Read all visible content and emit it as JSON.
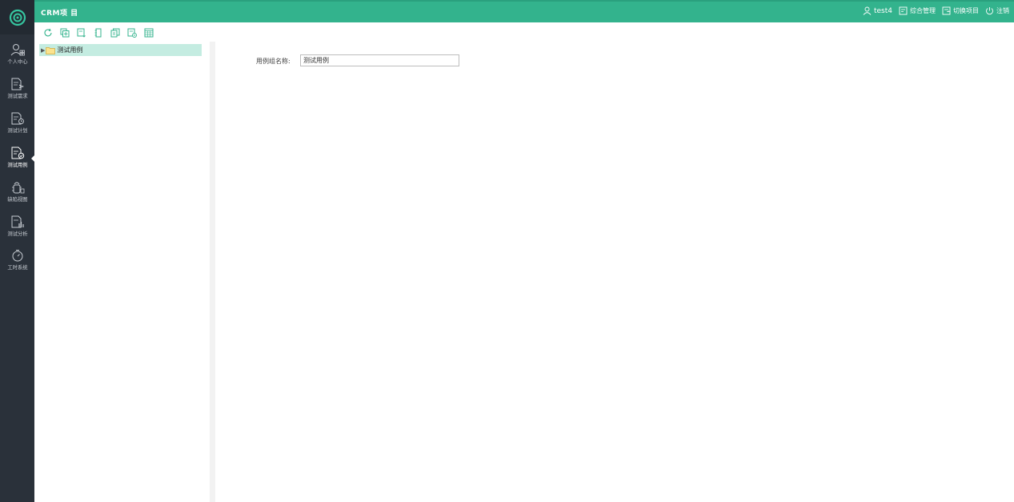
{
  "header": {
    "project_title": "CRM项 目",
    "username": "test4",
    "menu": [
      {
        "label": "综合管理",
        "icon": "management-icon"
      },
      {
        "label": "切换项目",
        "icon": "switch-project-icon"
      },
      {
        "label": "注销",
        "icon": "logout-icon"
      }
    ]
  },
  "sidebar": {
    "active_index": 3,
    "items": [
      {
        "label": "个人中心",
        "icon": "user-center-icon"
      },
      {
        "label": "测试需求",
        "icon": "test-requirements-icon"
      },
      {
        "label": "测试计划",
        "icon": "test-plan-icon"
      },
      {
        "label": "测试用例",
        "icon": "test-case-icon"
      },
      {
        "label": "缺陷视图",
        "icon": "defect-view-icon"
      },
      {
        "label": "测试分析",
        "icon": "test-analysis-icon"
      },
      {
        "label": "工时系统",
        "icon": "timesheet-icon"
      }
    ]
  },
  "toolbar": {
    "buttons": [
      "refresh-icon",
      "add-icon",
      "import-icon",
      "edit-icon",
      "copy-icon",
      "delete-icon",
      "calendar-icon"
    ]
  },
  "tree": {
    "root_label": "测试用例"
  },
  "form": {
    "group_name_label": "用例组名称:",
    "group_name_value": "测试用例"
  },
  "colors": {
    "accent": "#33b38d",
    "sidebar_bg": "#2a313a",
    "tree_selected": "#c4ece1"
  }
}
